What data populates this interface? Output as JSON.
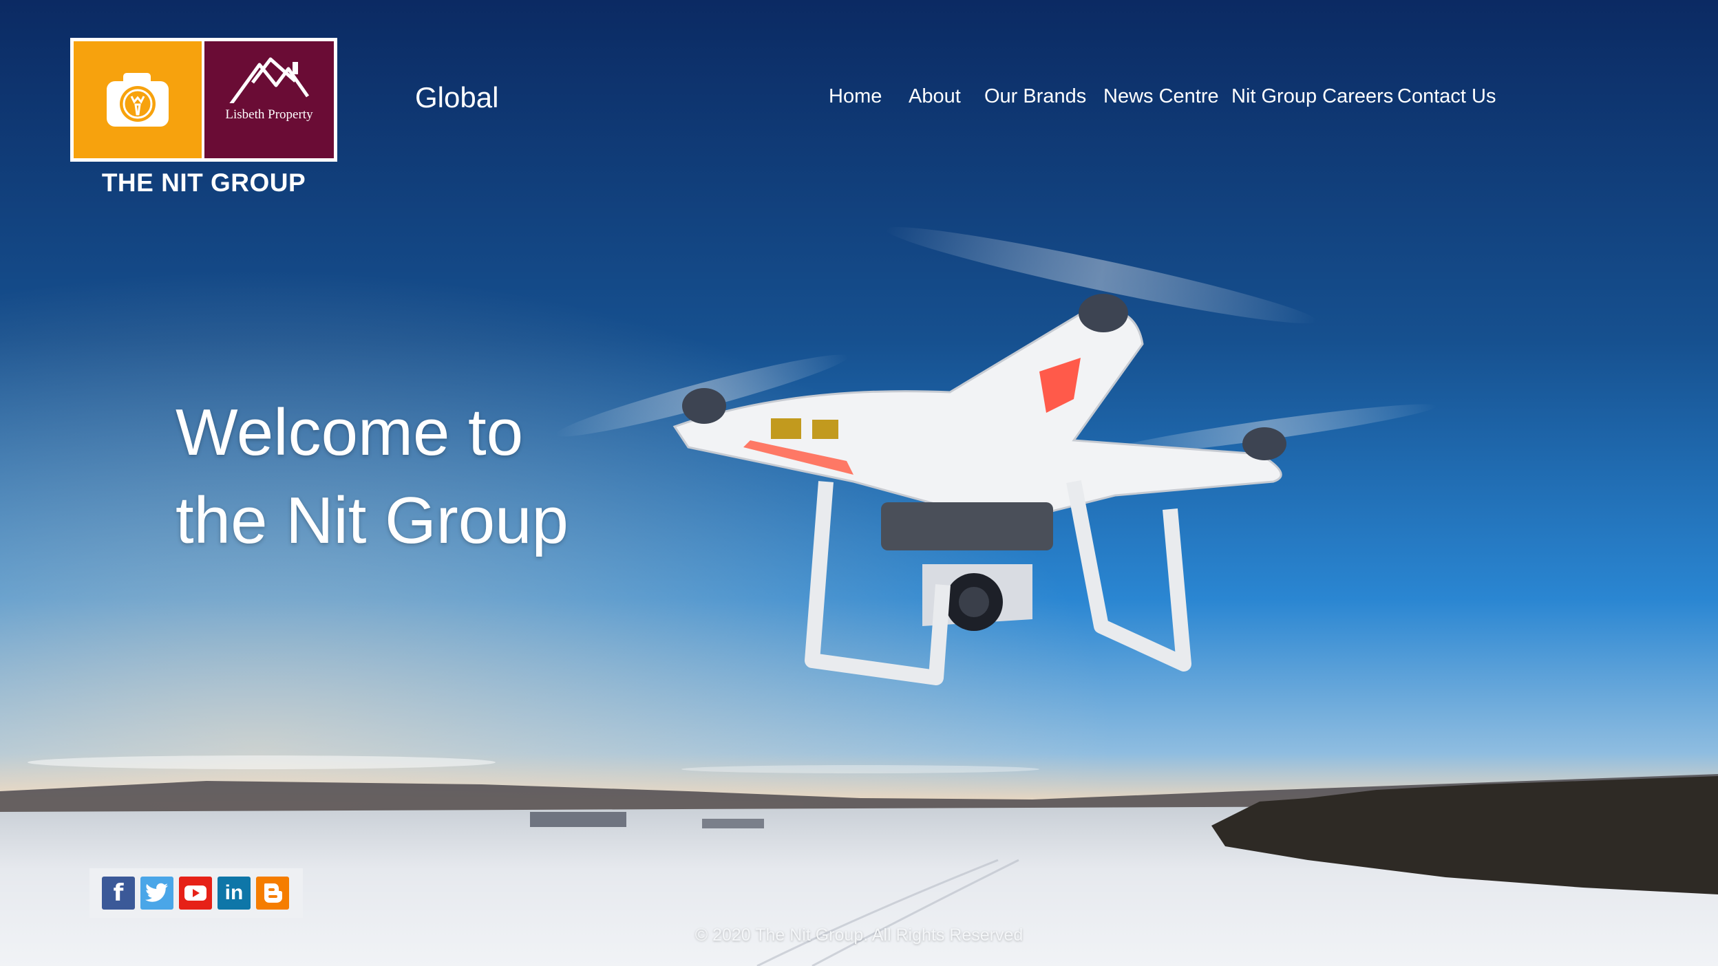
{
  "header": {
    "logo_sub_text": "Lisbeth Property",
    "brand_name": "THE NIT GROUP",
    "region": "Global"
  },
  "nav": {
    "items": [
      {
        "label": "Home"
      },
      {
        "label": "About"
      },
      {
        "label": "Our Brands"
      },
      {
        "label": "News Centre"
      },
      {
        "label": "Nit Group Careers"
      },
      {
        "label": "Contact Us"
      }
    ]
  },
  "hero": {
    "line1": "Welcome to",
    "line2": "the Nit Group"
  },
  "social": {
    "icons": [
      "facebook-icon",
      "twitter-icon",
      "youtube-icon",
      "linkedin-icon",
      "blogger-icon"
    ]
  },
  "footer": {
    "copyright": "© 2020 The Nit Group. All Rights Reserved"
  },
  "colors": {
    "logo_orange": "#f7a20d",
    "logo_maroon": "#6a0c35",
    "sky_top": "#0b2a63",
    "sky_mid": "#1f74c6",
    "snow": "#e9ecef"
  }
}
